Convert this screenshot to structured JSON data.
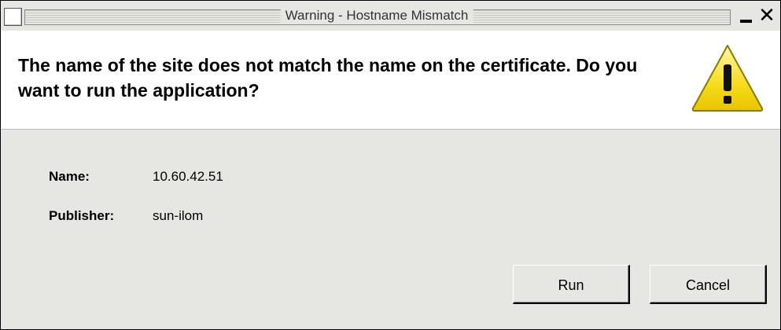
{
  "window": {
    "title": "Warning - Hostname Mismatch"
  },
  "header": {
    "message": "The name of the site does not match the name on the certificate.  Do you want to run the application?",
    "icon": "warning-triangle-icon"
  },
  "details": {
    "name_label": "Name:",
    "name_value": "10.60.42.51",
    "publisher_label": "Publisher:",
    "publisher_value": "sun-ilom"
  },
  "buttons": {
    "run": "Run",
    "cancel": "Cancel"
  },
  "colors": {
    "background": "#e6e6e3",
    "header_bg": "#ffffff",
    "warning_yellow": "#f2d40e"
  }
}
